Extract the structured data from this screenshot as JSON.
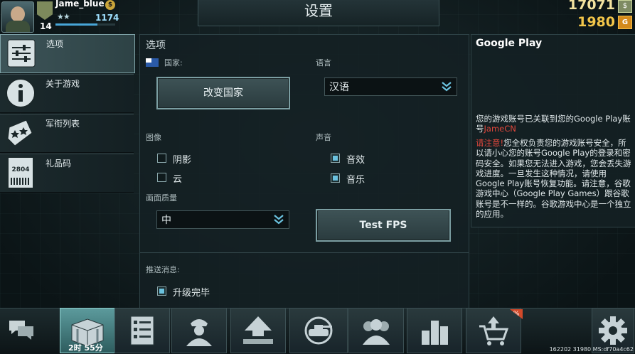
{
  "player": {
    "name": "Jame_blue",
    "level": "14",
    "xp": "1174",
    "stars": "★★",
    "xp_fraction": 0.7
  },
  "currency": {
    "silver": "17071",
    "gold": "1980",
    "silver_icon": "$",
    "gold_icon": "G"
  },
  "title": "设置",
  "sidebar": {
    "items": [
      {
        "label": "选项",
        "icon": "sliders-icon",
        "active": true
      },
      {
        "label": "关于游戏",
        "icon": "info-icon",
        "active": false
      },
      {
        "label": "军衔列表",
        "icon": "rank-icon",
        "active": false
      },
      {
        "label": "礼品码",
        "icon": "gift-code-icon",
        "active": false,
        "code_text": "2804"
      }
    ]
  },
  "options": {
    "heading": "选项",
    "country_label": "国家:",
    "language_label": "语言",
    "change_country_button": "改变国家",
    "language_value": "汉语",
    "graphics_label": "图像",
    "sound_label": "声音",
    "shadow_label": "阴影",
    "shadow_checked": false,
    "cloud_label": "云",
    "cloud_checked": false,
    "sfx_label": "音效",
    "sfx_checked": true,
    "music_label": "音乐",
    "music_checked": true,
    "quality_label": "画面质量",
    "quality_value": "中",
    "test_fps_button": "Test FPS",
    "push_label": "推送消息:",
    "upgrade_done_label": "升级完毕",
    "upgrade_done_checked": true
  },
  "google_play": {
    "title": "Google Play",
    "linked_text": "您的游戏账号已关联到您的Google Play账号",
    "account": "JameCN",
    "warning_prefix": "请注意!",
    "warning_text": "您全权负责您的游戏账号安全，所以请小心您的账号Google Play的登录和密码安全。如果您无法进入游戏，您会丢失游戏进度。一旦发生这种情况，请使用Google Play账号恢复功能。请注意，谷歌游戏中心（Google Play Games）跟谷歌账号是不一样的。谷歌游戏中心是一个独立的应用。"
  },
  "bottom_bar": {
    "items": [
      {
        "icon": "chat-icon"
      },
      {
        "icon": "crate-icon",
        "timer": "2时 55分"
      },
      {
        "icon": "checklist-icon"
      },
      {
        "icon": "commander-icon"
      },
      {
        "icon": "upgrade-icon"
      },
      {
        "icon": "tank-icon"
      },
      {
        "icon": "clan-icon"
      },
      {
        "icon": "leaderboard-icon"
      },
      {
        "icon": "shop-cart-icon",
        "badge": "%"
      },
      {
        "icon": "gear-icon"
      }
    ],
    "build_text": "162202 31980 MS:df70a4c62"
  },
  "colors": {
    "accent": "#6bc2df",
    "warning": "#e0473c",
    "gold": "#f3c64a"
  }
}
